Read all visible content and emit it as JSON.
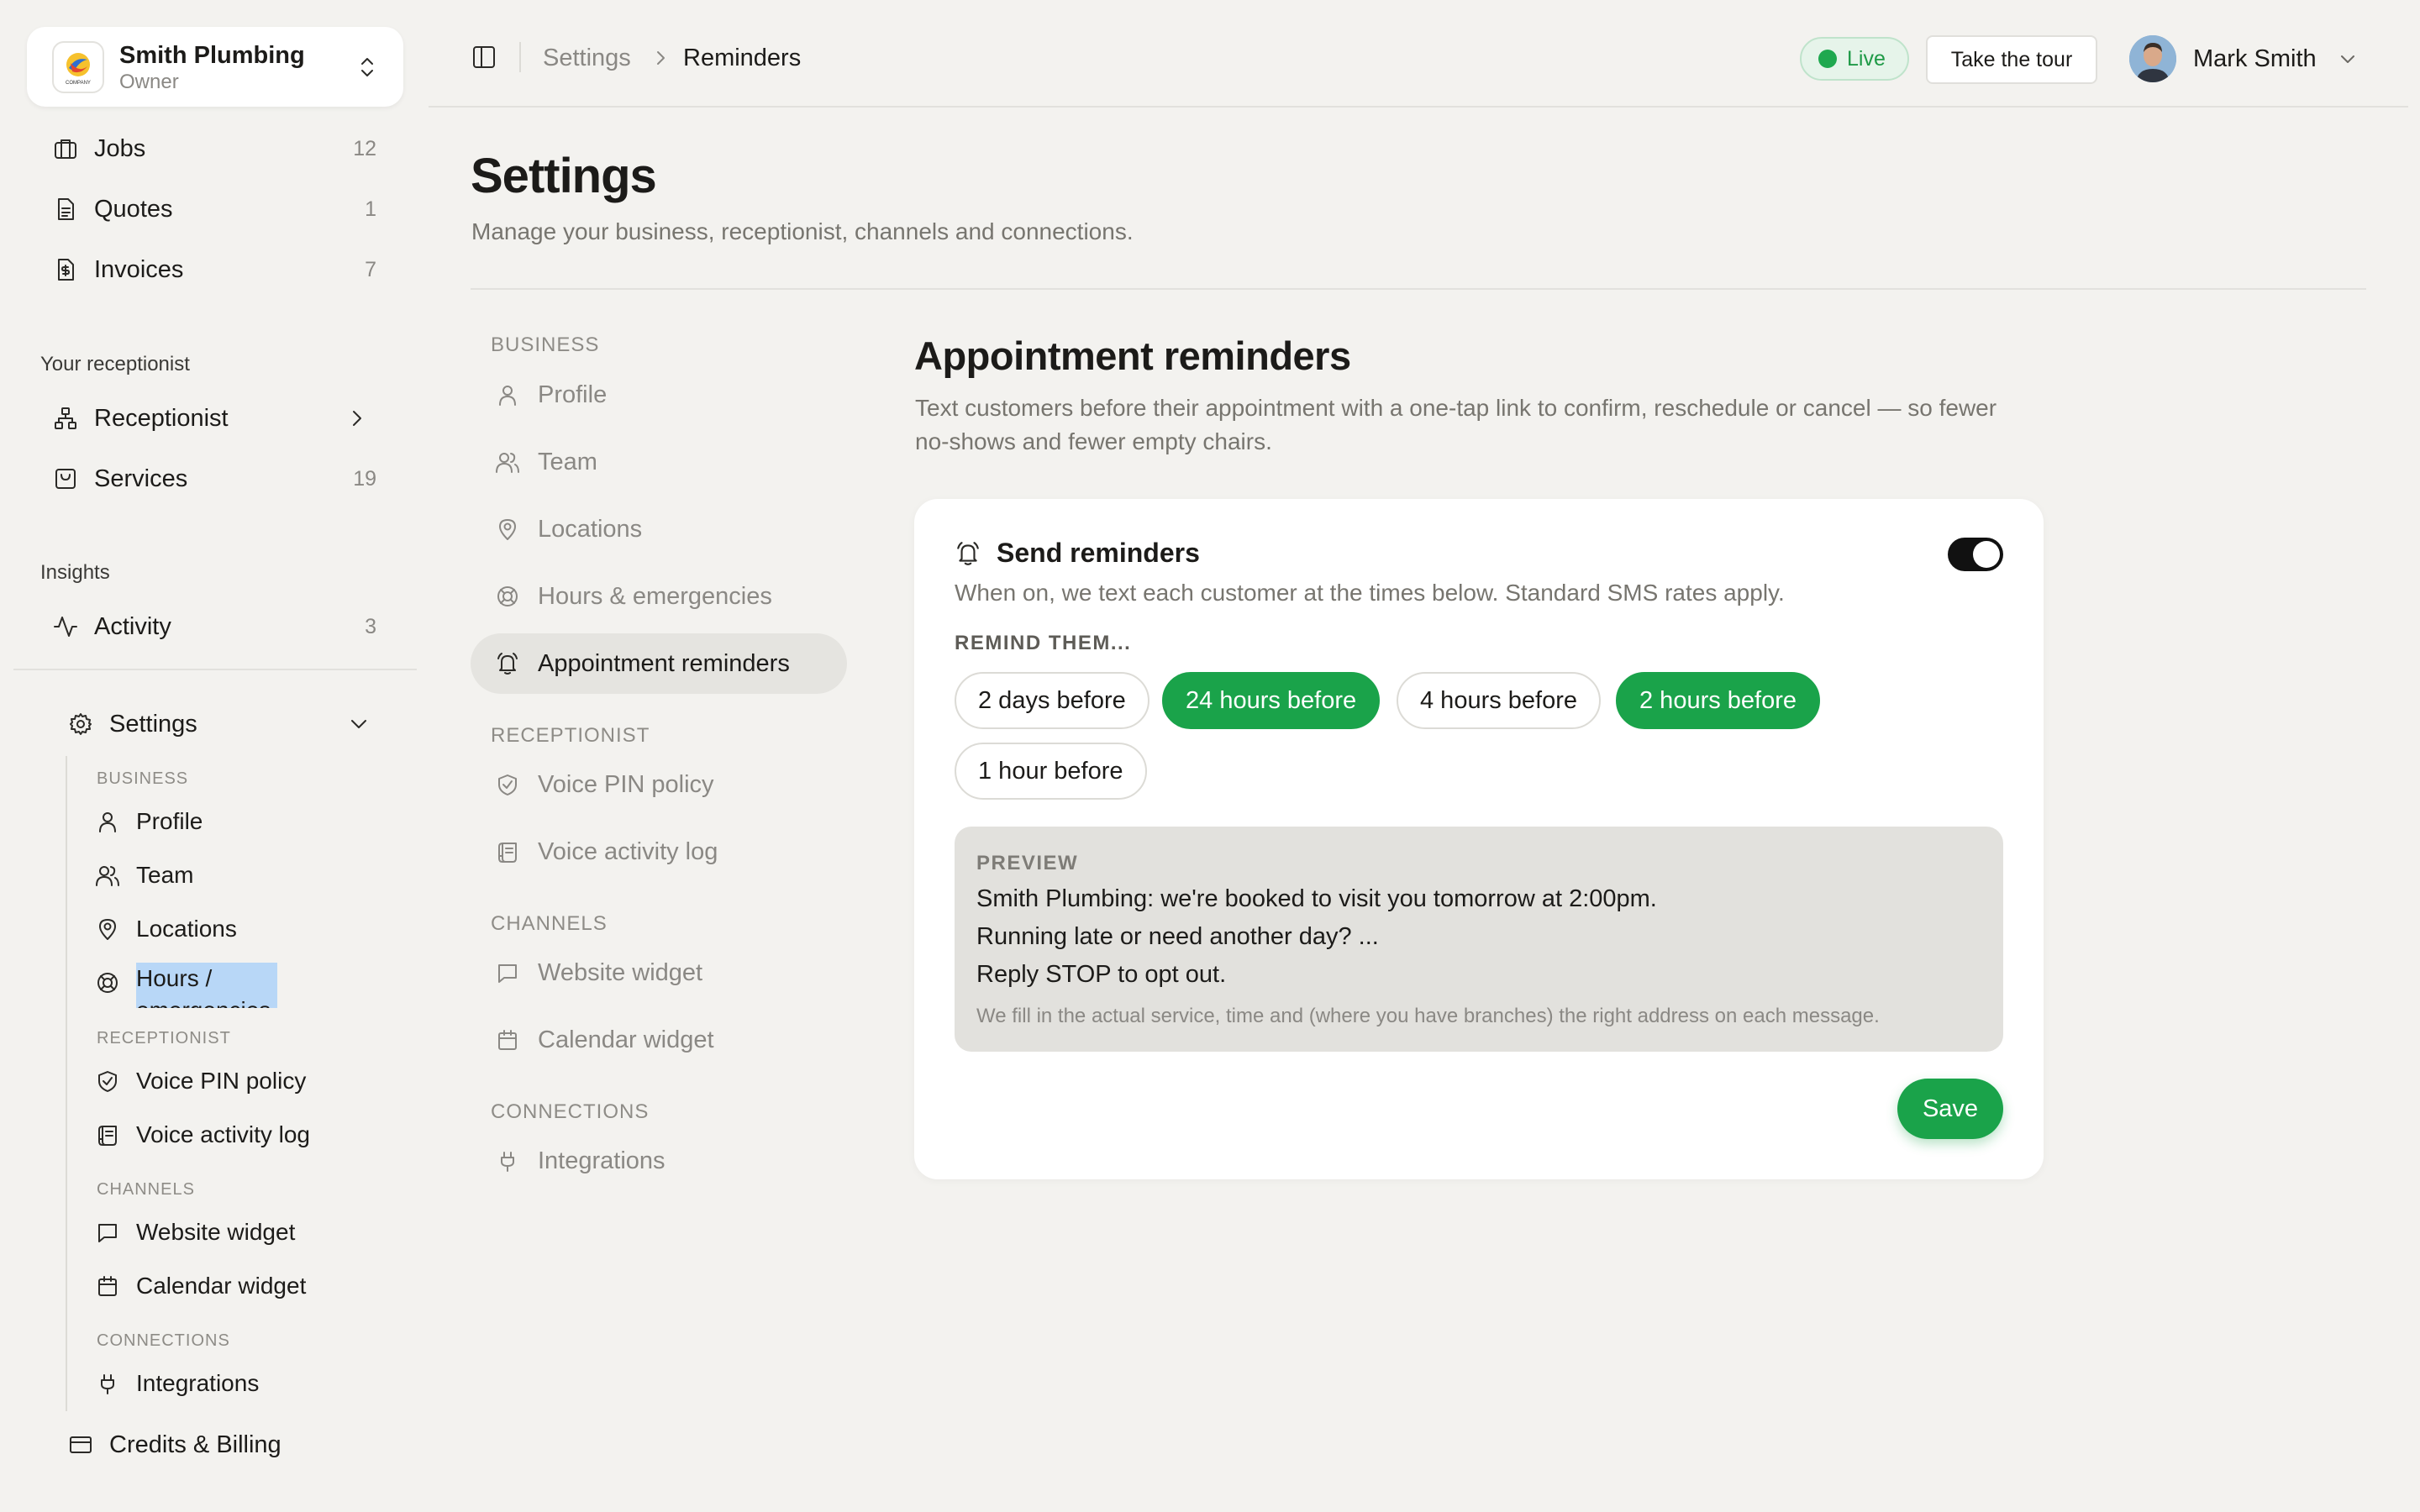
{
  "org": {
    "name": "Smith Plumbing",
    "role": "Owner",
    "logo_text": "COMPANY"
  },
  "sidebar": {
    "main_items": [
      {
        "label": "Jobs",
        "count": "12",
        "icon": "briefcase-icon"
      },
      {
        "label": "Quotes",
        "count": "1",
        "icon": "document-icon"
      },
      {
        "label": "Invoices",
        "count": "7",
        "icon": "invoice-icon"
      }
    ],
    "receptionist_heading": "Your receptionist",
    "receptionist_items": [
      {
        "label": "Receptionist",
        "icon": "network-icon"
      },
      {
        "label": "Services",
        "count": "19",
        "icon": "bag-icon"
      }
    ],
    "insights_heading": "Insights",
    "insights_items": [
      {
        "label": "Activity",
        "count": "3",
        "icon": "activity-icon"
      }
    ],
    "settings_label": "Settings",
    "settings_sub": {
      "business_heading": "BUSINESS",
      "business": [
        "Profile",
        "Team",
        "Locations",
        "Hours / emergencies"
      ],
      "receptionist_heading": "RECEPTIONIST",
      "receptionist": [
        "Voice PIN policy",
        "Voice activity log"
      ],
      "channels_heading": "CHANNELS",
      "channels": [
        "Website widget",
        "Calendar widget"
      ],
      "connections_heading": "CONNECTIONS",
      "connections": [
        "Integrations"
      ]
    },
    "billing_label": "Credits & Billing"
  },
  "topbar": {
    "breadcrumb": [
      "Settings",
      "Reminders"
    ],
    "live_label": "Live",
    "tour_label": "Take the tour",
    "user_name": "Mark Smith"
  },
  "page": {
    "title": "Settings",
    "subtitle": "Manage your business, receptionist, channels and connections."
  },
  "settings_nav": {
    "business_heading": "BUSINESS",
    "business": [
      "Profile",
      "Team",
      "Locations",
      "Hours & emergencies",
      "Appointment reminders"
    ],
    "receptionist_heading": "RECEPTIONIST",
    "receptionist": [
      "Voice PIN policy",
      "Voice activity log"
    ],
    "channels_heading": "CHANNELS",
    "channels": [
      "Website widget",
      "Calendar widget"
    ],
    "connections_heading": "CONNECTIONS",
    "connections": [
      "Integrations"
    ],
    "active": "Appointment reminders"
  },
  "section": {
    "title": "Appointment reminders",
    "description": "Text customers before their appointment with a one-tap link to confirm, reschedule or cancel — so fewer no-shows and fewer empty chairs."
  },
  "reminders_card": {
    "title": "Send reminders",
    "enabled": true,
    "subtitle": "When on, we text each customer at the times below. Standard SMS rates apply.",
    "remind_label": "REMIND THEM...",
    "options": [
      {
        "label": "2 days before",
        "selected": false
      },
      {
        "label": "24 hours before",
        "selected": true
      },
      {
        "label": "4 hours before",
        "selected": false
      },
      {
        "label": "2 hours before",
        "selected": true
      },
      {
        "label": "1 hour before",
        "selected": false
      }
    ],
    "preview_label": "PREVIEW",
    "preview_lines": [
      "Smith Plumbing: we're booked to visit you tomorrow at 2:00pm.",
      "Running late or need another day? ...",
      "Reply STOP to opt out."
    ],
    "preview_note": "We fill in the actual service, time and (where you have branches) the right address on each message.",
    "save_label": "Save"
  },
  "colors": {
    "accent": "#1aa34a",
    "background": "#f3f2ef",
    "card": "#ffffff",
    "live_bg": "#e6f4ea"
  }
}
